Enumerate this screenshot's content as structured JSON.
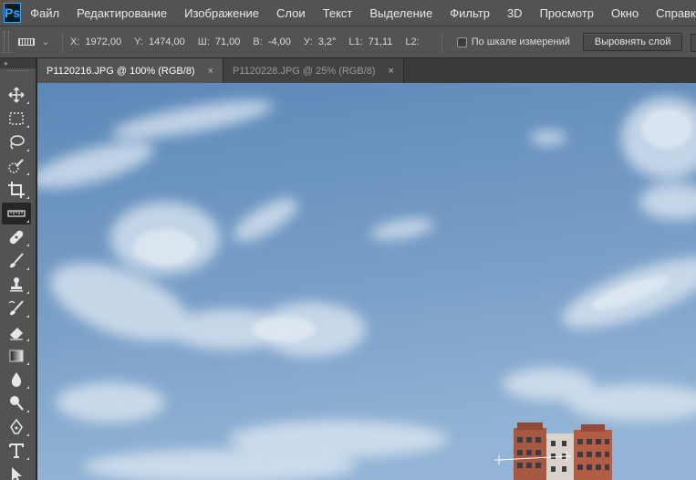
{
  "app": {
    "logo": "Ps"
  },
  "menu": [
    "Файл",
    "Редактирование",
    "Изображение",
    "Слои",
    "Текст",
    "Выделение",
    "Фильтр",
    "3D",
    "Просмотр",
    "Окно",
    "Справка"
  ],
  "options": {
    "tool_icon": "ruler-icon",
    "x_label": "X:",
    "x_value": "1972,00",
    "y_label": "Y:",
    "y_value": "1474,00",
    "w_label": "Ш:",
    "w_value": "71,00",
    "h_label": "В:",
    "h_value": "-4,00",
    "angle_label": "У:",
    "angle_value": "3,2°",
    "l1_label": "L1:",
    "l1_value": "71,11",
    "l2_label": "L2:",
    "l2_value": "",
    "scale_checkbox_label": "По шкале измерений",
    "scale_checkbox_checked": false,
    "straighten_button": "Выровнять слой"
  },
  "toolpanel": {
    "collapse_label": "»"
  },
  "tabs": [
    {
      "label": "P1120216.JPG @ 100% (RGB/8)",
      "close": "×",
      "active": true
    },
    {
      "label": "P1120228.JPG @ 25% (RGB/8)",
      "close": "×",
      "active": false
    }
  ],
  "tools": [
    "move-icon",
    "marquee-icon",
    "lasso-icon",
    "quick-selection-icon",
    "crop-icon",
    "ruler-icon",
    "healing-brush-icon",
    "brush-icon",
    "clone-stamp-icon",
    "history-brush-icon",
    "eraser-icon",
    "gradient-icon",
    "blur-icon",
    "dodge-icon",
    "pen-icon",
    "type-icon",
    "path-selection-icon"
  ],
  "colors": {
    "sky_top": "#5a86b6",
    "sky_bottom": "#8fb1d3",
    "panel": "#535353",
    "building": "#a8553f"
  }
}
